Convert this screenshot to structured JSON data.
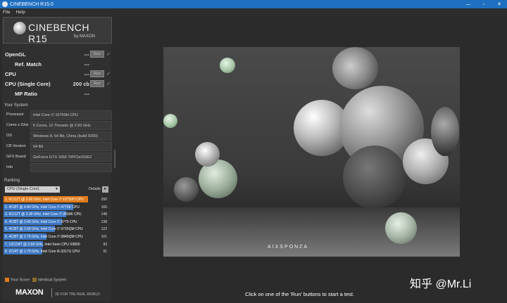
{
  "window": {
    "title": "CINEBENCH R15.0",
    "minimize": "—",
    "maximize": "▫",
    "close": "✕"
  },
  "menu": [
    "File",
    "Help"
  ],
  "logo": {
    "title": "CINEBENCH R15",
    "subtitle": "by MAXON"
  },
  "benchmarks": [
    {
      "label": "OpenGL",
      "value": "---",
      "run": "Run",
      "check": "✓",
      "indent": false
    },
    {
      "label": "Ref. Match",
      "value": "---",
      "run": "",
      "check": "",
      "indent": true
    },
    {
      "label": "CPU",
      "value": "---",
      "run": "Run",
      "check": "✓",
      "indent": false
    },
    {
      "label": "CPU (Single Core)",
      "value": "200 cb",
      "run": "Run",
      "check": "✓",
      "indent": false
    },
    {
      "label": "MP Ratio",
      "value": "---",
      "run": "",
      "check": "",
      "indent": true
    }
  ],
  "system": {
    "title": "Your System",
    "rows": [
      {
        "key": "Processor",
        "value": "Intel Core i7-10750H CPU"
      },
      {
        "key": "Cores x GHz",
        "value": "6 Cores, 12 Threads @ 2.60 GHz"
      },
      {
        "key": "OS",
        "value": "Windows 8, 64 Bit, China (build 9200)"
      },
      {
        "key": "CB Version",
        "value": "64 Bit"
      },
      {
        "key": "GFX Board",
        "value": "GeForce GTX 1650 Ti/PCIe/SSE2"
      },
      {
        "key": "Info",
        "value": ""
      }
    ]
  },
  "ranking": {
    "title": "Ranking",
    "dropdown": "CPU (Single Core)",
    "details_label": "Details",
    "rows": [
      {
        "text": "1. 6C/12T @ 2.60 GHz, Intel Core i7-10750H CPU",
        "score": "200",
        "fraction": 1.0,
        "color": "#e07b1a"
      },
      {
        "text": "2. 4C/8T @ 4.40 GHz, Intel Core i7-4770K CPU",
        "score": "165",
        "fraction": 0.825,
        "color": "#3d78c4"
      },
      {
        "text": "3. 6C/12T @ 3.30 GHz, Intel Core i7-3930K CPU",
        "score": "148",
        "fraction": 0.74,
        "color": "#3d78c4"
      },
      {
        "text": "4. 4C/8T @ 3.40 GHz, Intel Core i7-3770 CPU",
        "score": "138",
        "fraction": 0.69,
        "color": "#3d78c4"
      },
      {
        "text": "5. 4C/8T @ 2.60 GHz, Intel Core i7-3720QM CPU",
        "score": "122",
        "fraction": 0.61,
        "color": "#3d78c4"
      },
      {
        "text": "6. 4C/8T @ 2.79 GHz, Intel Core i7-3840QM CPU",
        "score": "101",
        "fraction": 0.505,
        "color": "#3d78c4"
      },
      {
        "text": "7. 12C/24T @ 2.66 GHz, Intel Xeon CPU X5650",
        "score": "93",
        "fraction": 0.465,
        "color": "#3d78c4"
      },
      {
        "text": "8. 2C/4T @ 1.70 GHz, Intel Core i5-3317U CPU",
        "score": "91",
        "fraction": 0.455,
        "color": "#3d78c4"
      }
    ]
  },
  "legend": {
    "your_score": "Your Score",
    "identical": "Identical System",
    "your_color": "#e07b1a",
    "identical_color": "#8a6a2a"
  },
  "footer": {
    "brand": "MAXON",
    "tagline": "3D FOR THE REAL WORLD"
  },
  "render_signature": "AIXSPONZA",
  "status": "Click on one of the 'Run' buttons to start a test.",
  "watermark": "知乎 @Mr.Li"
}
